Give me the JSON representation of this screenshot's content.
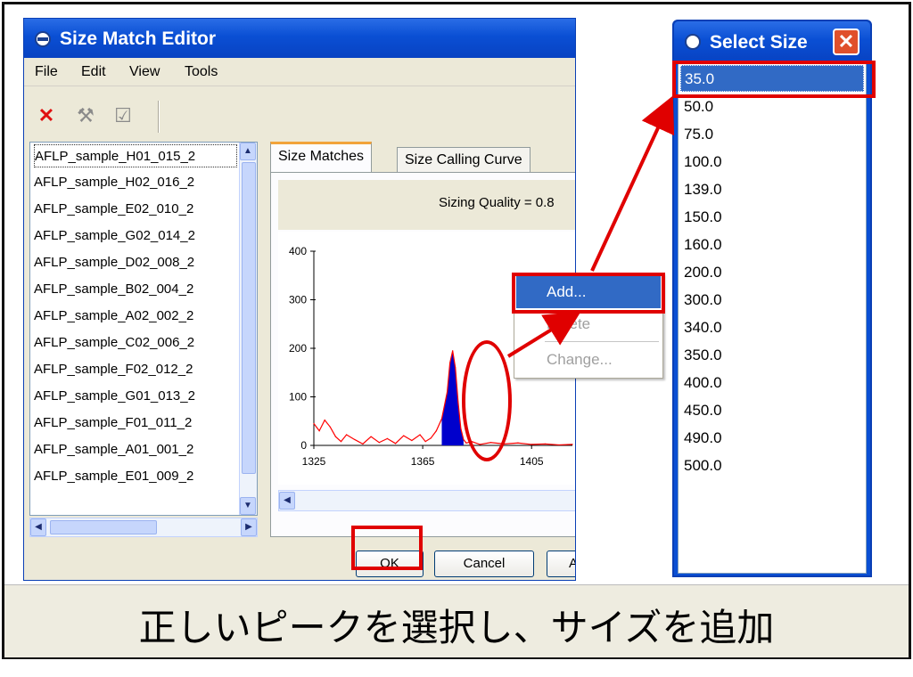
{
  "editor": {
    "title": "Size Match Editor",
    "menu": [
      "File",
      "Edit",
      "View",
      "Tools"
    ],
    "samples": [
      "AFLP_sample_H01_015_2",
      "AFLP_sample_H02_016_2",
      "AFLP_sample_E02_010_2",
      "AFLP_sample_G02_014_2",
      "AFLP_sample_D02_008_2",
      "AFLP_sample_B02_004_2",
      "AFLP_sample_A02_002_2",
      "AFLP_sample_C02_006_2",
      "AFLP_sample_F02_012_2",
      "AFLP_sample_G01_013_2",
      "AFLP_sample_F01_011_2",
      "AFLP_sample_A01_001_2",
      "AFLP_sample_E01_009_2"
    ],
    "tabs": [
      "Size Matches",
      "Size Calling Curve"
    ],
    "sizing_quality": "Sizing Quality = 0.8",
    "buttons": {
      "ok": "OK",
      "cancel": "Cancel",
      "third": "A"
    }
  },
  "context_menu": {
    "add": "Add...",
    "delete": "Delete",
    "change": "Change..."
  },
  "select_size": {
    "title": "Select Size",
    "close": "✕",
    "sizes": [
      "35.0",
      "50.0",
      "75.0",
      "100.0",
      "139.0",
      "150.0",
      "160.0",
      "200.0",
      "300.0",
      "340.0",
      "350.0",
      "400.0",
      "450.0",
      "490.0",
      "500.0"
    ]
  },
  "caption": "正しいピークを選択し、サイズを追加",
  "colors": {
    "highlight": "#e00000",
    "selection": "#316ac5",
    "peak": "#0000cc",
    "trace": "#ff0000"
  },
  "chart_data": {
    "type": "line",
    "x_ticks": [
      "1325",
      "1365",
      "1405"
    ],
    "y_ticks": [
      "0",
      "100",
      "200",
      "300",
      "400"
    ],
    "ylim": [
      0,
      400
    ],
    "xlim": [
      1325,
      1420
    ],
    "series": [
      {
        "x": [
          1325,
          1327,
          1329,
          1331,
          1333,
          1335,
          1337,
          1340,
          1343,
          1346,
          1349,
          1352,
          1355,
          1358,
          1361,
          1364,
          1366,
          1368,
          1370,
          1372,
          1374,
          1375,
          1376,
          1377,
          1378,
          1379,
          1380,
          1381,
          1383,
          1386,
          1390,
          1395,
          1400,
          1405,
          1410,
          1415,
          1420
        ],
        "y": [
          45,
          30,
          52,
          38,
          18,
          8,
          22,
          12,
          3,
          18,
          6,
          14,
          4,
          20,
          10,
          22,
          8,
          15,
          30,
          55,
          110,
          170,
          195,
          160,
          90,
          35,
          12,
          5,
          8,
          2,
          6,
          3,
          5,
          2,
          3,
          1,
          2
        ]
      }
    ],
    "filled_peak": [
      1372,
      1380
    ]
  }
}
